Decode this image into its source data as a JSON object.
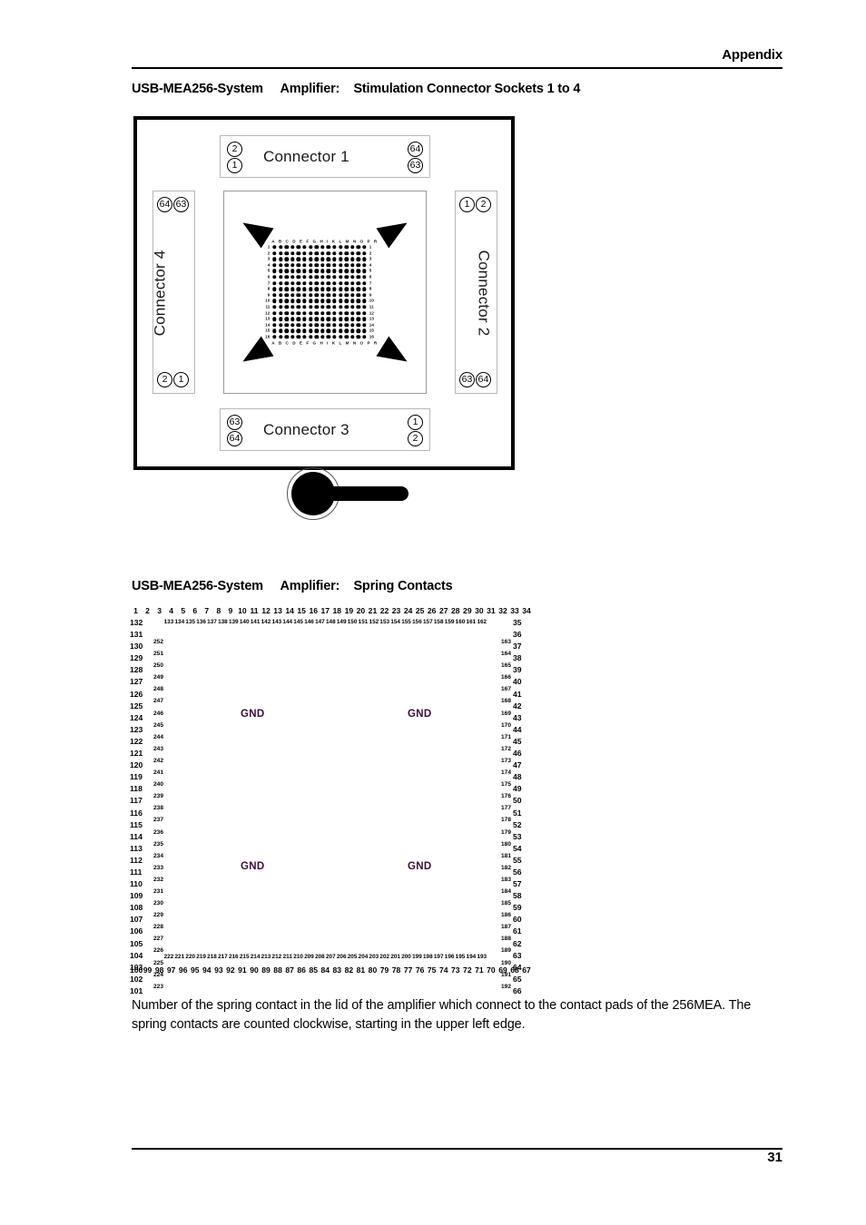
{
  "header": {
    "title": "Appendix"
  },
  "footer": {
    "page_number": "31"
  },
  "sections": [
    {
      "id": "stimulation-connector-sockets",
      "title": "USB-MEA256-System     Amplifier:    Stimulation Connector Sockets 1 to 4"
    },
    {
      "id": "spring-contacts",
      "title": "USB-MEA256-System     Amplifier:    Spring Contacts"
    }
  ],
  "figure_connectors": {
    "connector1": {
      "label": "Connector 1",
      "pins": {
        "top_left": "2",
        "bottom_left": "1",
        "top_right": "64",
        "bottom_right": "63"
      }
    },
    "connector2": {
      "label": "Connector 2",
      "pins": {
        "top_left": "1",
        "top_right": "2",
        "bottom_left": "63",
        "bottom_right": "64"
      }
    },
    "connector3": {
      "label": "Connector 3",
      "pins": {
        "top_left": "63",
        "bottom_left": "64",
        "top_right": "1",
        "bottom_right": "2"
      }
    },
    "connector4": {
      "label": "Connector 4",
      "pins": {
        "top_left": "64",
        "top_right": "63",
        "bottom_left": "2",
        "bottom_right": "1"
      }
    },
    "mea_grid": {
      "columns": "A B C D E F G H I K L M N O P R",
      "column_letters": [
        "A",
        "B",
        "C",
        "D",
        "E",
        "F",
        "G",
        "H",
        "I",
        "K",
        "L",
        "M",
        "N",
        "O",
        "P",
        "R"
      ],
      "rows": [
        "1",
        "2",
        "3",
        "4",
        "5",
        "6",
        "7",
        "8",
        "9",
        "10",
        "11",
        "12",
        "13",
        "14",
        "15",
        "16"
      ],
      "grid_size": "16 x 16",
      "electrode_count": 256
    }
  },
  "chart_data": {
    "type": "table",
    "title": "USB-MEA256-System Amplifier: Spring Contacts",
    "description": "Spring contact numbering map, counted clockwise starting at the upper left edge",
    "top_outer": [
      "1",
      "2",
      "3",
      "4",
      "5",
      "6",
      "7",
      "8",
      "9",
      "10",
      "11",
      "12",
      "13",
      "14",
      "15",
      "16",
      "17",
      "18",
      "19",
      "20",
      "21",
      "22",
      "23",
      "24",
      "25",
      "26",
      "27",
      "28",
      "29",
      "30",
      "31",
      "32",
      "33",
      "34"
    ],
    "top_inner": [
      "133",
      "134",
      "135",
      "136",
      "137",
      "138",
      "139",
      "140",
      "141",
      "142",
      "143",
      "144",
      "145",
      "146",
      "147",
      "148",
      "149",
      "150",
      "151",
      "152",
      "153",
      "154",
      "155",
      "156",
      "157",
      "158",
      "159",
      "160",
      "161",
      "162"
    ],
    "left_outer": [
      "132",
      "131",
      "130",
      "129",
      "128",
      "127",
      "126",
      "125",
      "124",
      "123",
      "122",
      "121",
      "120",
      "119",
      "118",
      "117",
      "116",
      "115",
      "114",
      "113",
      "112",
      "111",
      "110",
      "109",
      "108",
      "107",
      "106",
      "105",
      "104",
      "103",
      "102",
      "101"
    ],
    "left_inner": [
      "252",
      "251",
      "250",
      "249",
      "248",
      "247",
      "246",
      "245",
      "244",
      "243",
      "242",
      "241",
      "240",
      "239",
      "238",
      "237",
      "236",
      "235",
      "234",
      "233",
      "232",
      "231",
      "230",
      "229",
      "228",
      "227",
      "226",
      "225",
      "224",
      "223"
    ],
    "right_inner": [
      "163",
      "164",
      "165",
      "166",
      "167",
      "168",
      "169",
      "170",
      "171",
      "172",
      "173",
      "174",
      "175",
      "176",
      "177",
      "178",
      "179",
      "180",
      "181",
      "182",
      "183",
      "184",
      "185",
      "186",
      "187",
      "188",
      "189",
      "190",
      "191",
      "192"
    ],
    "right_outer": [
      "35",
      "36",
      "37",
      "38",
      "39",
      "40",
      "41",
      "42",
      "43",
      "44",
      "45",
      "46",
      "47",
      "48",
      "49",
      "50",
      "51",
      "52",
      "53",
      "54",
      "55",
      "56",
      "57",
      "58",
      "59",
      "60",
      "61",
      "62",
      "63",
      "64",
      "65",
      "66"
    ],
    "bottom_inner": [
      "222",
      "221",
      "220",
      "219",
      "218",
      "217",
      "216",
      "215",
      "214",
      "213",
      "212",
      "211",
      "210",
      "209",
      "208",
      "207",
      "206",
      "205",
      "204",
      "203",
      "202",
      "201",
      "200",
      "199",
      "198",
      "197",
      "196",
      "195",
      "194",
      "193"
    ],
    "bottom_outer": [
      "100",
      "99",
      "98",
      "97",
      "96",
      "95",
      "94",
      "93",
      "92",
      "91",
      "90",
      "89",
      "88",
      "87",
      "86",
      "85",
      "84",
      "83",
      "82",
      "81",
      "80",
      "79",
      "78",
      "77",
      "76",
      "75",
      "74",
      "73",
      "72",
      "71",
      "70",
      "69",
      "68",
      "67"
    ],
    "gnd_labels": [
      "GND",
      "GND",
      "GND",
      "GND"
    ],
    "gnd_color": "#3d0a3d"
  },
  "caption": {
    "text": "Number of the spring contact in the lid of the amplifier which connect to the contact pads of the 256MEA. The spring contacts are counted clockwise, starting in the upper left edge."
  },
  "colors": {
    "text": "#000000",
    "gnd": "#3d0a3d",
    "rule": "#000000",
    "panel_border": "#9a9a9a"
  }
}
